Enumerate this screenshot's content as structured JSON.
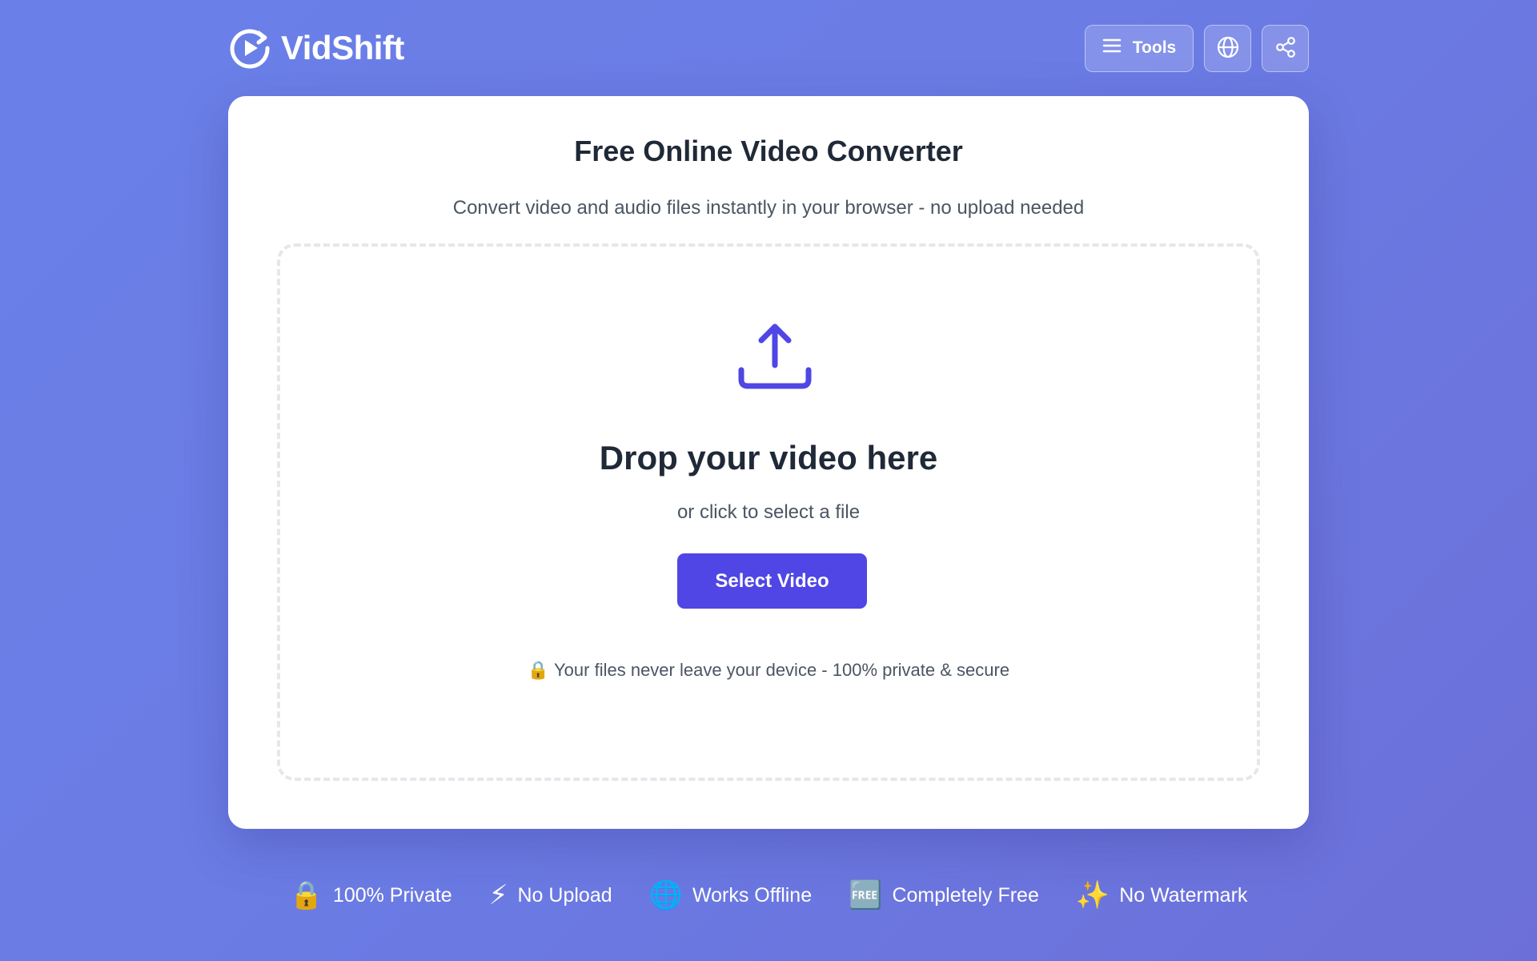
{
  "brand": {
    "name": "VidShift",
    "icon": "play-refresh-icon"
  },
  "header": {
    "tools_label": "Tools",
    "tools_icon": "menu-icon",
    "language_icon": "globe-icon",
    "share_icon": "share-icon"
  },
  "card": {
    "title": "Free Online Video Converter",
    "subtitle": "Convert video and audio files instantly in your browser - no upload needed"
  },
  "dropzone": {
    "icon": "upload-icon",
    "title": "Drop your video here",
    "subtitle": "or click to select a file",
    "button_label": "Select Video",
    "privacy_note": "🔒 Your files never leave your device - 100% private & secure"
  },
  "features": [
    {
      "emoji": "🔒",
      "label": "100% Private"
    },
    {
      "emoji": "⚡",
      "label": "No Upload"
    },
    {
      "emoji": "🌐",
      "label": "Works Offline"
    },
    {
      "emoji": "🆓",
      "label": "Completely Free"
    },
    {
      "emoji": "✨",
      "label": "No Watermark"
    }
  ],
  "colors": {
    "accent": "#4f46e5",
    "background_start": "#6a80e8",
    "background_end": "#6c6fd8",
    "heading": "#1f2937",
    "body_text": "#4b5563"
  }
}
